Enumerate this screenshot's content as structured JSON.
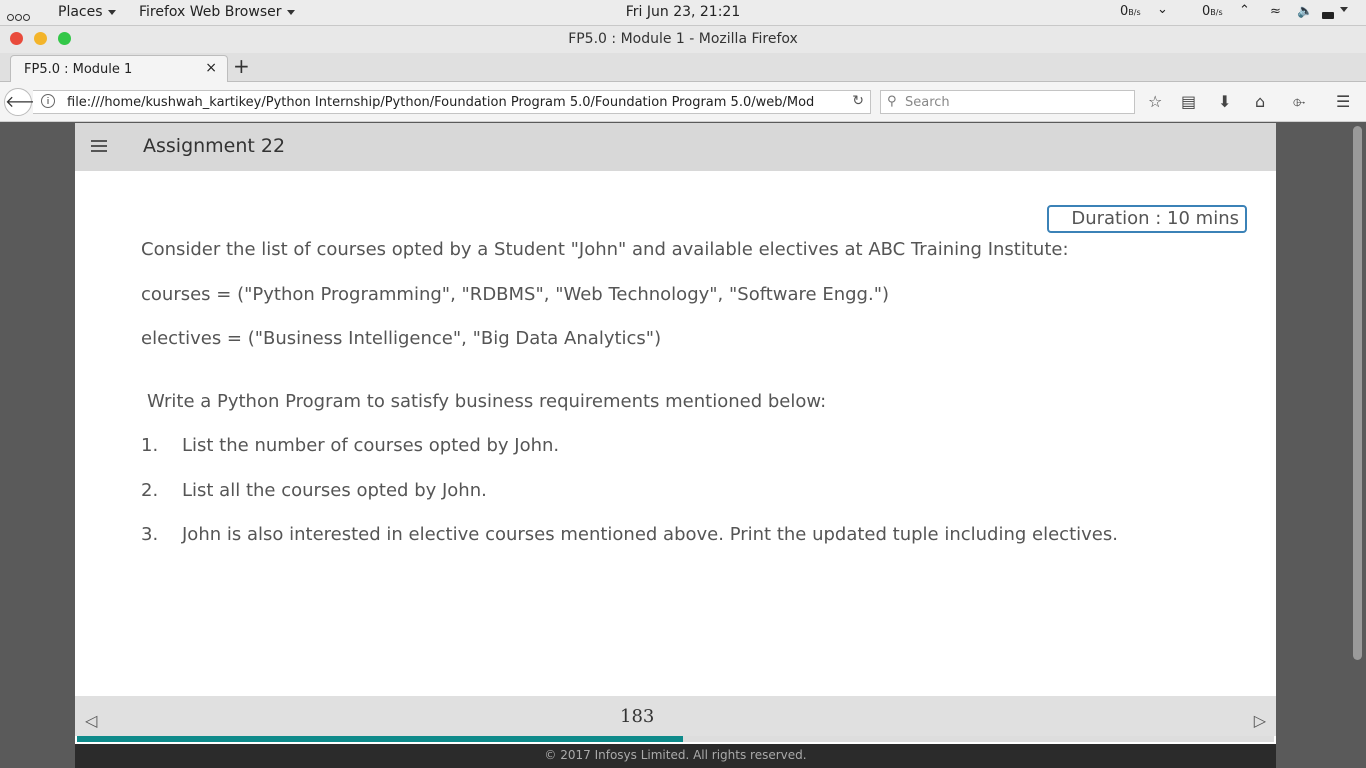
{
  "topbar": {
    "places": "Places",
    "app": "Firefox Web Browser",
    "clock": "Fri Jun 23, 21:21",
    "net_down": "0",
    "net_down_unit": "B/s",
    "net_up": "0",
    "net_up_unit": "B/s"
  },
  "window": {
    "title": "FP5.0 : Module 1 - Mozilla Firefox"
  },
  "tab": {
    "label": "FP5.0 : Module 1"
  },
  "navbar": {
    "url": "file:///home/kushwah_kartikey/Python Internship/Python/Foundation Program 5.0/Foundation Program 5.0/web/Mod",
    "search_placeholder": "Search"
  },
  "page": {
    "title": "Assignment 22",
    "duration": "Duration : 10 mins",
    "intro": "Consider the list of courses opted by a Student \"John\" and available electives at ABC Training Institute:",
    "courses_line": "courses = (\"Python Programming\", \"RDBMS\", \"Web Technology\", \"Software Engg.\")",
    "electives_line": "electives = (\"Business Intelligence\", \"Big Data Analytics\")",
    "task": "Write a Python Program to satisfy business requirements mentioned below:",
    "requirements": [
      {
        "num": "1.",
        "text": "List the number of courses opted by John."
      },
      {
        "num": "2.",
        "text": "List all the courses opted by John."
      },
      {
        "num": "3.",
        "text": "John is also interested in elective courses mentioned above. Print the updated tuple including electives."
      }
    ],
    "page_number": "183",
    "progress_fraction": 0.506,
    "copyright": "© 2017 Infosys Limited. All rights reserved."
  },
  "colors": {
    "accent": "#3b82b7",
    "progress": "#0e8a8a",
    "close": "#e94b3c",
    "minimize": "#f3b42a",
    "maximize": "#33c748"
  }
}
